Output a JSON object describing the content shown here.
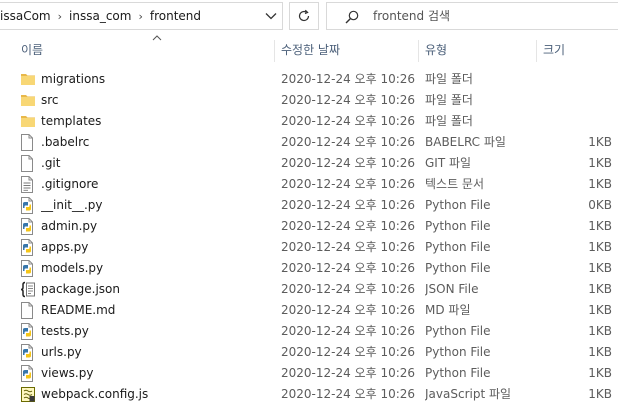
{
  "address_bar": {
    "breadcrumbs": [
      "issaCom",
      "inssa_com",
      "frontend"
    ],
    "search_placeholder": "frontend 검색"
  },
  "columns": {
    "name": "이름",
    "date": "수정한 날짜",
    "type": "유형",
    "size": "크기"
  },
  "files": [
    {
      "name": "migrations",
      "date": "2020-12-24 오후 10:26",
      "type": "파일 폴더",
      "size": "",
      "icon": "folder-icon"
    },
    {
      "name": "src",
      "date": "2020-12-24 오후 10:26",
      "type": "파일 폴더",
      "size": "",
      "icon": "folder-icon"
    },
    {
      "name": "templates",
      "date": "2020-12-24 오후 10:26",
      "type": "파일 폴더",
      "size": "",
      "icon": "folder-icon"
    },
    {
      "name": ".babelrc",
      "date": "2020-12-24 오후 10:26",
      "type": "BABELRC 파일",
      "size": "1KB",
      "icon": "blank-file-icon"
    },
    {
      "name": ".git",
      "date": "2020-12-24 오후 10:26",
      "type": "GIT 파일",
      "size": "1KB",
      "icon": "blank-file-icon"
    },
    {
      "name": ".gitignore",
      "date": "2020-12-24 오후 10:26",
      "type": "텍스트 문서",
      "size": "1KB",
      "icon": "text-file-icon"
    },
    {
      "name": "__init__.py",
      "date": "2020-12-24 오후 10:26",
      "type": "Python File",
      "size": "0KB",
      "icon": "python-file-icon"
    },
    {
      "name": "admin.py",
      "date": "2020-12-24 오후 10:26",
      "type": "Python File",
      "size": "1KB",
      "icon": "python-file-icon"
    },
    {
      "name": "apps.py",
      "date": "2020-12-24 오후 10:26",
      "type": "Python File",
      "size": "1KB",
      "icon": "python-file-icon"
    },
    {
      "name": "models.py",
      "date": "2020-12-24 오후 10:26",
      "type": "Python File",
      "size": "1KB",
      "icon": "python-file-icon"
    },
    {
      "name": "package.json",
      "date": "2020-12-24 오후 10:26",
      "type": "JSON File",
      "size": "1KB",
      "icon": "json-file-icon"
    },
    {
      "name": "README.md",
      "date": "2020-12-24 오후 10:26",
      "type": "MD 파일",
      "size": "1KB",
      "icon": "blank-file-icon"
    },
    {
      "name": "tests.py",
      "date": "2020-12-24 오후 10:26",
      "type": "Python File",
      "size": "1KB",
      "icon": "python-file-icon"
    },
    {
      "name": "urls.py",
      "date": "2020-12-24 오후 10:26",
      "type": "Python File",
      "size": "1KB",
      "icon": "python-file-icon"
    },
    {
      "name": "views.py",
      "date": "2020-12-24 오후 10:26",
      "type": "Python File",
      "size": "1KB",
      "icon": "python-file-icon"
    },
    {
      "name": "webpack.config.js",
      "date": "2020-12-24 오후 10:26",
      "type": "JavaScript 파일",
      "size": "1KB",
      "icon": "javascript-file-icon"
    }
  ],
  "colors": {
    "folder": "#f8d775",
    "folder_dark": "#e8b84a",
    "header_text": "#4c607a",
    "hover": "#e5f3ff"
  }
}
